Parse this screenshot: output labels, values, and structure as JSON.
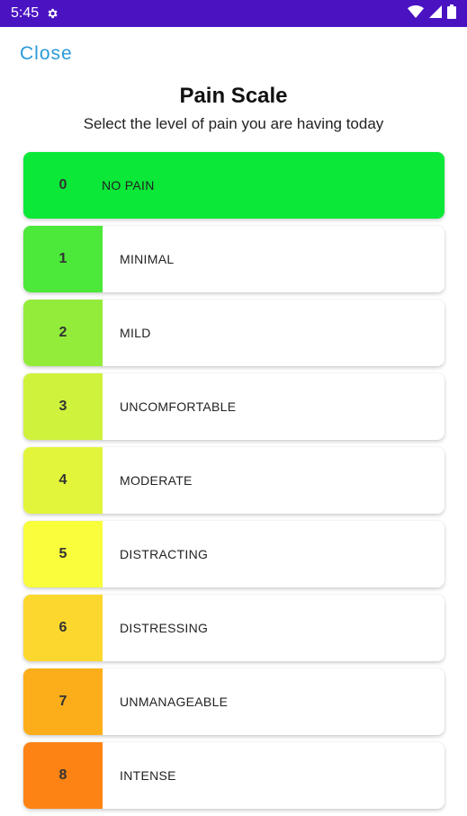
{
  "status_bar": {
    "time": "5:45",
    "icons": [
      "gear-icon",
      "wifi-icon",
      "signal-icon",
      "battery-icon"
    ]
  },
  "header": {
    "close_label": "Close",
    "title": "Pain Scale",
    "subtitle": "Select the level of pain you are having today"
  },
  "colors": {
    "status_bar": "#4a13c2",
    "close_link": "#2a9ad8"
  },
  "scale": [
    {
      "level": "0",
      "label": "NO PAIN",
      "color": "#0be838",
      "selected": true
    },
    {
      "level": "1",
      "label": "MINIMAL",
      "color": "#4ce83a"
    },
    {
      "level": "2",
      "label": "MILD",
      "color": "#93ec3a"
    },
    {
      "level": "3",
      "label": "UNCOMFORTABLE",
      "color": "#cff23c"
    },
    {
      "level": "4",
      "label": "MODERATE",
      "color": "#e2f53b"
    },
    {
      "level": "5",
      "label": "DISTRACTING",
      "color": "#f8fd3c"
    },
    {
      "level": "6",
      "label": "DISTRESSING",
      "color": "#fcd82e"
    },
    {
      "level": "7",
      "label": "UNMANAGEABLE",
      "color": "#fcae1a"
    },
    {
      "level": "8",
      "label": "INTENSE",
      "color": "#fc8314"
    }
  ]
}
